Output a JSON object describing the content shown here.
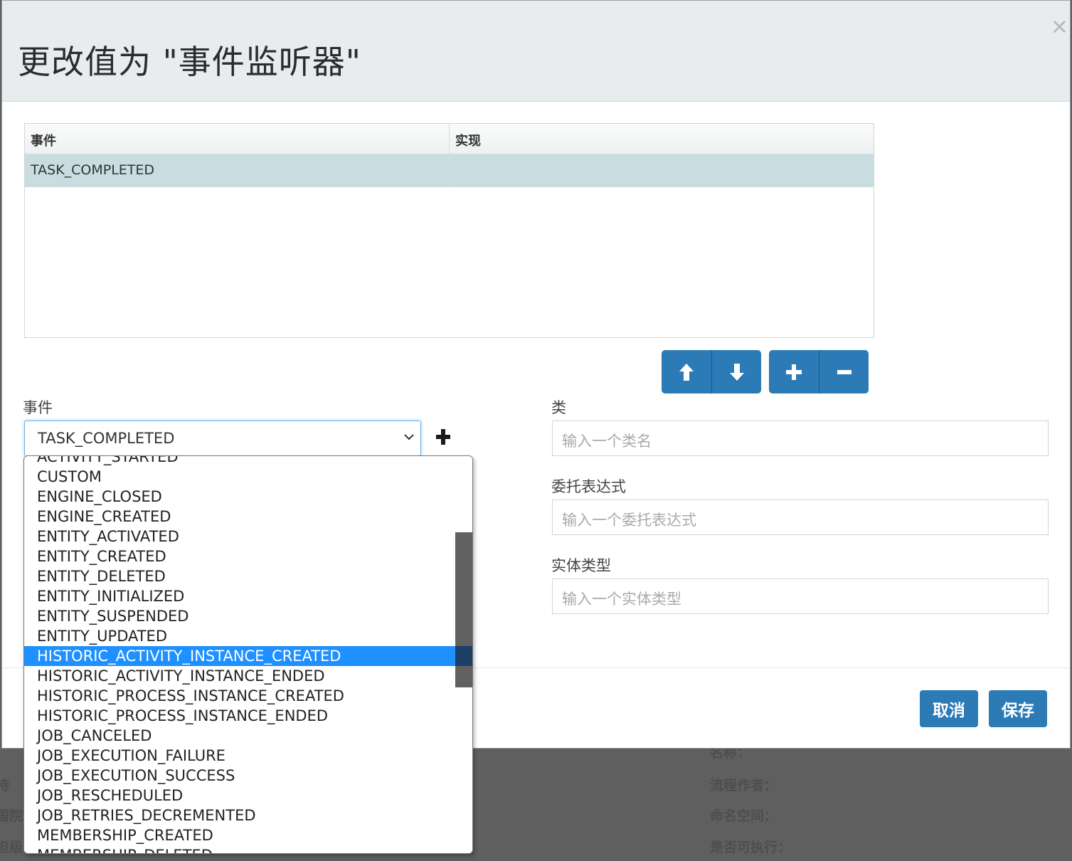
{
  "dialog": {
    "title": "更改值为 \"事件监听器\"",
    "close_symbol": "×"
  },
  "grid": {
    "columns": [
      "事件",
      "实现"
    ],
    "rows": [
      {
        "event": "TASK_COMPLETED",
        "implementation": ""
      }
    ]
  },
  "toolbar": {
    "move_up": "arrow-up-icon",
    "move_down": "arrow-down-icon",
    "add": "plus-icon",
    "remove": "minus-icon"
  },
  "form": {
    "event_label": "事件",
    "event_value": "TASK_COMPLETED",
    "class_label": "类",
    "class_placeholder": "输入一个类名",
    "delegate_label": "委托表达式",
    "delegate_placeholder": "输入一个委托表达式",
    "entity_label": "实体类型",
    "entity_placeholder": "输入一个实体类型"
  },
  "dropdown": {
    "partial_top": "ACTIVITY_STARTED",
    "items": [
      "CUSTOM",
      "ENGINE_CLOSED",
      "ENGINE_CREATED",
      "ENTITY_ACTIVATED",
      "ENTITY_CREATED",
      "ENTITY_DELETED",
      "ENTITY_INITIALIZED",
      "ENTITY_SUSPENDED",
      "ENTITY_UPDATED",
      "HISTORIC_ACTIVITY_INSTANCE_CREATED",
      "HISTORIC_ACTIVITY_INSTANCE_ENDED",
      "HISTORIC_PROCESS_INSTANCE_CREATED",
      "HISTORIC_PROCESS_INSTANCE_ENDED",
      "JOB_CANCELED",
      "JOB_EXECUTION_FAILURE",
      "JOB_EXECUTION_SUCCESS",
      "JOB_RESCHEDULED",
      "JOB_RETRIES_DECREMENTED",
      "MEMBERSHIP_CREATED"
    ],
    "partial_bottom": "MEMBERSHIP_DELETED",
    "selected": "HISTORIC_ACTIVITY_INSTANCE_CREATED"
  },
  "footer": {
    "cancel_label": "取消",
    "save_label": "保存"
  },
  "background_page": {
    "fields": [
      "名称：",
      "流程作者：",
      "命名空间：",
      "是否可执行："
    ],
    "left_fragments": [
      "持",
      "国院",
      "担级"
    ]
  },
  "colors": {
    "primary": "#2c7ab6",
    "selected_row": "#c9dde1",
    "dropdown_highlight": "#1e90ff"
  }
}
